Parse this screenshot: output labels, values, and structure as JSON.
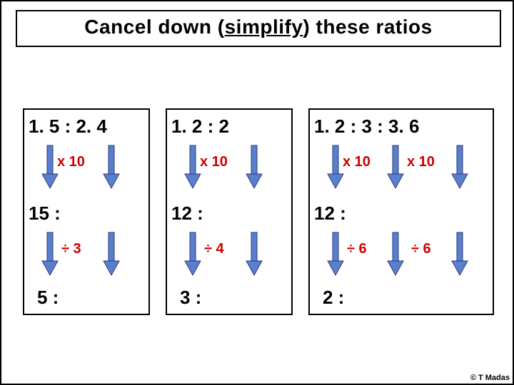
{
  "title": {
    "pre": "Cancel down ",
    "paren_open": "(",
    "word": "simplify",
    "paren_close": ")",
    "post": " these ratios"
  },
  "panels": {
    "p1": {
      "top": "1. 5 : 2. 4",
      "op1": "x 10",
      "mid": "15  :",
      "op2": "÷ 3",
      "bot": "5  :"
    },
    "p2": {
      "top": "1. 2  :  2",
      "op1": "x 10",
      "mid": "12  :",
      "op2": "÷ 4",
      "bot": "3  :"
    },
    "p3": {
      "top": "1. 2  :  3 :  3. 6",
      "op1a": "x 10",
      "op1b": "x 10",
      "mid": "12  :",
      "op2a": "÷ 6",
      "op2b": "÷ 6",
      "bot": "2  :"
    }
  },
  "credit": "© T Madas"
}
